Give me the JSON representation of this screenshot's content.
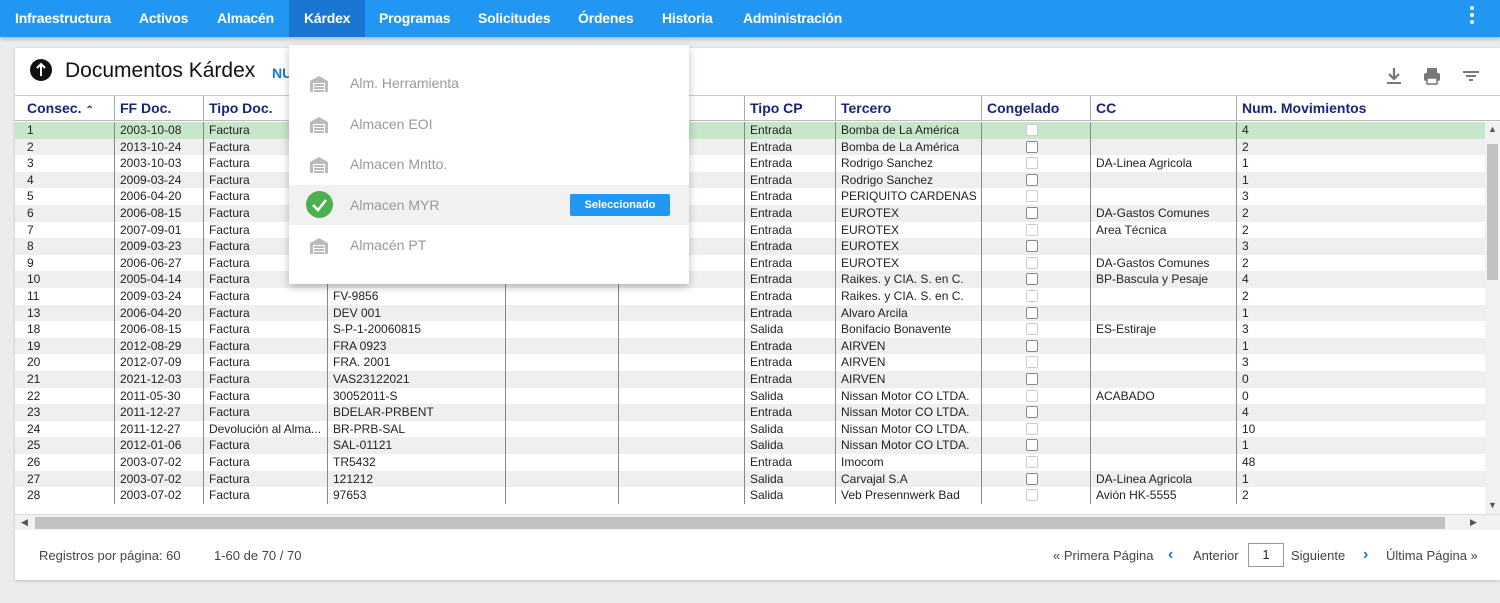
{
  "nav": {
    "items": [
      {
        "label": "Infraestructura"
      },
      {
        "label": "Activos"
      },
      {
        "label": "Almacén"
      },
      {
        "label": "Kárdex"
      },
      {
        "label": "Programas"
      },
      {
        "label": "Solicitudes"
      },
      {
        "label": "Órdenes"
      },
      {
        "label": "Historia"
      },
      {
        "label": "Administración"
      }
    ],
    "active": "Kárdex"
  },
  "page": {
    "title": "Documentos Kárdex",
    "title_link": "NU"
  },
  "dropdown": {
    "items": [
      {
        "label": "Alm. Herramienta",
        "selected": false
      },
      {
        "label": "Almacen EOI",
        "selected": false
      },
      {
        "label": "Almacen Mntto.",
        "selected": false
      },
      {
        "label": "Almacen MYR",
        "selected": true
      },
      {
        "label": "Almacén PT",
        "selected": false
      }
    ],
    "selected_badge": "Seleccionado"
  },
  "table": {
    "columns": [
      "Consec.",
      "FF Doc.",
      "Tipo Doc.",
      "",
      "",
      "",
      "Tipo CP",
      "Tercero",
      "Congelado",
      "CC",
      "Num. Movimientos"
    ],
    "rows": [
      {
        "consec": "1",
        "ff": "2003-10-08",
        "tipo": "Factura",
        "num": "",
        "tipocp": "Entrada",
        "tercero": "Bomba de La América",
        "cong": "dim",
        "cc": "",
        "mov": "4"
      },
      {
        "consec": "2",
        "ff": "2013-10-24",
        "tipo": "Factura",
        "num": "",
        "tipocp": "Entrada",
        "tercero": "Bomba de La América",
        "cong": "on",
        "cc": "",
        "mov": "2"
      },
      {
        "consec": "3",
        "ff": "2003-10-03",
        "tipo": "Factura",
        "num": "",
        "tipocp": "Entrada",
        "tercero": "Rodrigo Sanchez",
        "cong": "dim",
        "cc": "DA-Linea Agricola",
        "mov": "1"
      },
      {
        "consec": "4",
        "ff": "2009-03-24",
        "tipo": "Factura",
        "num": "",
        "tipocp": "Entrada",
        "tercero": "Rodrigo Sanchez",
        "cong": "on",
        "cc": "",
        "mov": "1"
      },
      {
        "consec": "5",
        "ff": "2006-04-20",
        "tipo": "Factura",
        "num": "",
        "tipocp": "Entrada",
        "tercero": "PERIQUITO CARDENAS",
        "cong": "dim",
        "cc": "",
        "mov": "3"
      },
      {
        "consec": "6",
        "ff": "2006-08-15",
        "tipo": "Factura",
        "num": "",
        "tipocp": "Entrada",
        "tercero": "EUROTEX",
        "cong": "on",
        "cc": "DA-Gastos Comunes",
        "mov": "2"
      },
      {
        "consec": "7",
        "ff": "2007-09-01",
        "tipo": "Factura",
        "num": "",
        "tipocp": "Entrada",
        "tercero": "EUROTEX",
        "cong": "dim",
        "cc": "Area Técnica",
        "mov": "2"
      },
      {
        "consec": "8",
        "ff": "2009-03-23",
        "tipo": "Factura",
        "num": "",
        "tipocp": "Entrada",
        "tercero": "EUROTEX",
        "cong": "on",
        "cc": "",
        "mov": "3"
      },
      {
        "consec": "9",
        "ff": "2006-06-27",
        "tipo": "Factura",
        "num": "",
        "tipocp": "Entrada",
        "tercero": "EUROTEX",
        "cong": "dim",
        "cc": "DA-Gastos Comunes",
        "mov": "2"
      },
      {
        "consec": "10",
        "ff": "2005-04-14",
        "tipo": "Factura",
        "num": "",
        "tipocp": "Entrada",
        "tercero": "Raikes. y CIA. S. en C.",
        "cong": "on",
        "cc": "BP-Bascula y Pesaje",
        "mov": "4"
      },
      {
        "consec": "11",
        "ff": "2009-03-24",
        "tipo": "Factura",
        "num": "FV-9856",
        "tipocp": "Entrada",
        "tercero": "Raikes. y CIA. S. en C.",
        "cong": "dim",
        "cc": "",
        "mov": "2"
      },
      {
        "consec": "13",
        "ff": "2006-04-20",
        "tipo": "Factura",
        "num": "DEV 001",
        "tipocp": "Entrada",
        "tercero": "Alvaro Arcila",
        "cong": "on",
        "cc": "",
        "mov": "1"
      },
      {
        "consec": "18",
        "ff": "2006-08-15",
        "tipo": "Factura",
        "num": "S-P-1-20060815",
        "tipocp": "Salida",
        "tercero": "Bonifacio Bonavente",
        "cong": "dim",
        "cc": "ES-Estiraje",
        "mov": "3"
      },
      {
        "consec": "19",
        "ff": "2012-08-29",
        "tipo": "Factura",
        "num": "FRA 0923",
        "tipocp": "Entrada",
        "tercero": "AIRVEN",
        "cong": "on",
        "cc": "",
        "mov": "1"
      },
      {
        "consec": "20",
        "ff": "2012-07-09",
        "tipo": "Factura",
        "num": "FRA. 2001",
        "tipocp": "Entrada",
        "tercero": "AIRVEN",
        "cong": "dim",
        "cc": "",
        "mov": "3"
      },
      {
        "consec": "21",
        "ff": "2021-12-03",
        "tipo": "Factura",
        "num": "VAS23122021",
        "tipocp": "Entrada",
        "tercero": "AIRVEN",
        "cong": "on",
        "cc": "",
        "mov": "0"
      },
      {
        "consec": "22",
        "ff": "2011-05-30",
        "tipo": "Factura",
        "num": "30052011-S",
        "tipocp": "Salida",
        "tercero": "Nissan Motor CO LTDA.",
        "cong": "dim",
        "cc": "ACABADO",
        "mov": "0"
      },
      {
        "consec": "23",
        "ff": "2011-12-27",
        "tipo": "Factura",
        "num": "BDELAR-PRBENT",
        "tipocp": "Entrada",
        "tercero": "Nissan Motor CO LTDA.",
        "cong": "on",
        "cc": "",
        "mov": "4"
      },
      {
        "consec": "24",
        "ff": "2011-12-27",
        "tipo": "Devolución al Alma...",
        "num": "BR-PRB-SAL",
        "tipocp": "Salida",
        "tercero": "Nissan Motor CO LTDA.",
        "cong": "dim",
        "cc": "",
        "mov": "10"
      },
      {
        "consec": "25",
        "ff": "2012-01-06",
        "tipo": "Factura",
        "num": "SAL-01121",
        "tipocp": "Salida",
        "tercero": "Nissan Motor CO LTDA.",
        "cong": "on",
        "cc": "",
        "mov": "1"
      },
      {
        "consec": "26",
        "ff": "2003-07-02",
        "tipo": "Factura",
        "num": "TR5432",
        "tipocp": "Entrada",
        "tercero": "Imocom",
        "cong": "dim",
        "cc": "",
        "mov": "48"
      },
      {
        "consec": "27",
        "ff": "2003-07-02",
        "tipo": "Factura",
        "num": "121212",
        "tipocp": "Salida",
        "tercero": "Carvajal S.A",
        "cong": "on",
        "cc": "DA-Linea Agricola",
        "mov": "1"
      },
      {
        "consec": "28",
        "ff": "2003-07-02",
        "tipo": "Factura",
        "num": "97653",
        "tipocp": "Salida",
        "tercero": "Veb Presennwerk Bad",
        "cong": "dim",
        "cc": "Avión HK-5555",
        "mov": "2"
      }
    ]
  },
  "footer": {
    "per_page": "Registros por página: 60",
    "range": "1-60 de 70 / 70",
    "first": "« Primera Página",
    "prev": "Anterior",
    "page_value": "1",
    "next": "Siguiente",
    "last": "Última Página »"
  },
  "colors": {
    "nav": "#2196f3",
    "nav_active": "#1976d2",
    "selected_row": "#c8e6c9",
    "check": "#4caf50",
    "badge": "#2196f3"
  },
  "icons": [
    "kardex-icon",
    "download-icon",
    "print-icon",
    "filter-icon",
    "kebab-menu-icon",
    "warehouse-icon",
    "check-icon",
    "chevron-left-icon",
    "chevron-right-icon"
  ]
}
